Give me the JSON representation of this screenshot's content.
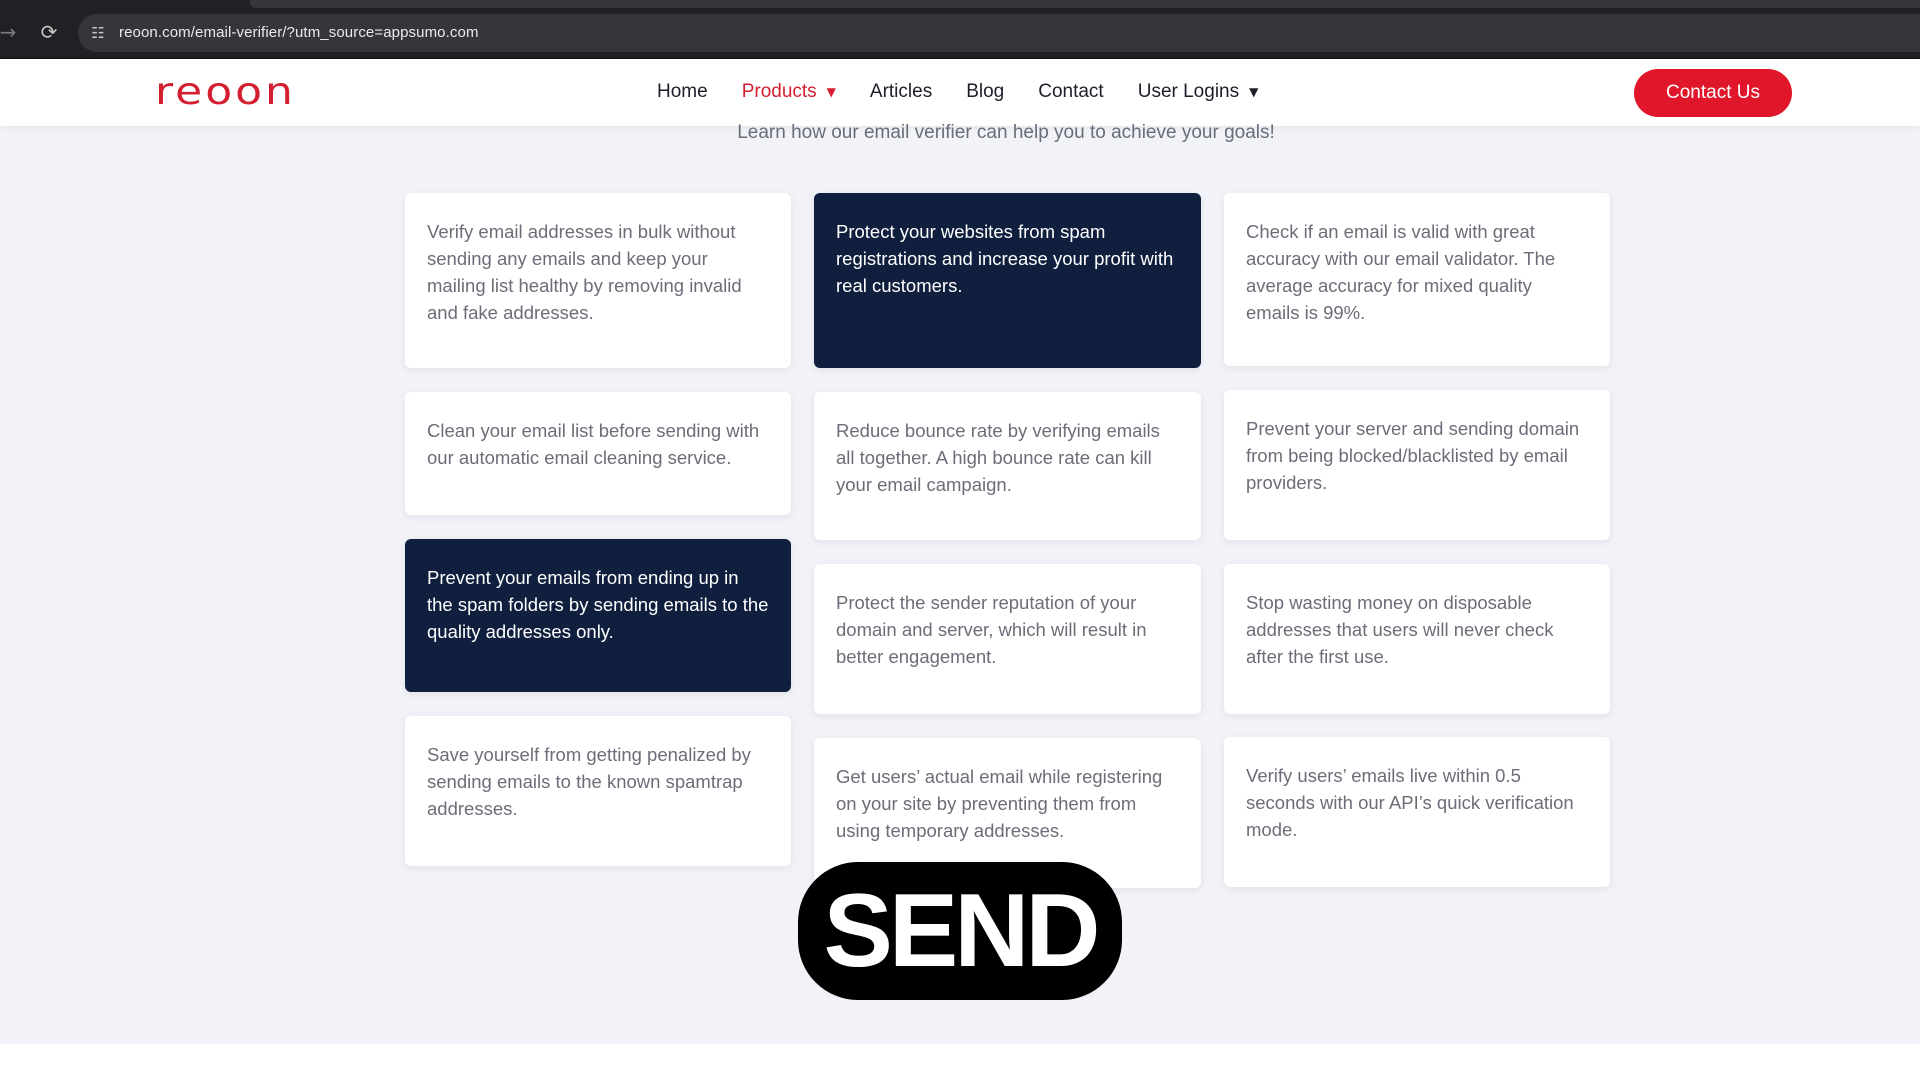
{
  "browser": {
    "url": "reoon.com/email-verifier/?utm_source=appsumo.com"
  },
  "header": {
    "logo_text": "reoon",
    "menu": [
      {
        "label": "Home"
      },
      {
        "label": "Products"
      },
      {
        "label": "Articles"
      },
      {
        "label": "Blog"
      },
      {
        "label": "Contact"
      },
      {
        "label": "User Logins"
      }
    ],
    "contact_button": "Contact Us"
  },
  "main": {
    "subtitle": "Learn how our email verifier can help you to achieve your goals!",
    "cards": [
      {
        "text": "Verify email addresses in bulk without sending any emails and keep your mailing list healthy by removing invalid and fake addresses."
      },
      {
        "text": "Protect your websites from spam registrations and increase your profit with real customers."
      },
      {
        "text": "Check if an email is valid with great accuracy with our email validator. The average accuracy for mixed quality emails is 99%."
      },
      {
        "text": "Clean your email list before sending with our automatic email cleaning service."
      },
      {
        "text": "Reduce bounce rate by verifying emails all together. A high bounce rate can kill your email campaign."
      },
      {
        "text": "Prevent your server and sending domain from being blocked/blacklisted by email providers."
      },
      {
        "text": "Prevent your emails from ending up in the spam folders by sending emails to the quality addresses only."
      },
      {
        "text": "Protect the sender reputation of your domain and server, which will result in better engagement."
      },
      {
        "text": "Stop wasting money on disposable addresses that users will never check after the first use."
      },
      {
        "text": "Save yourself from getting penalized by sending emails to the known spamtrap addresses."
      },
      {
        "text": "Get users’ actual email while registering on your site by preventing them from using temporary addresses."
      },
      {
        "text": "Verify users’ emails live within 0.5 seconds with our API’s quick verification mode."
      }
    ]
  },
  "overlay": {
    "caption": "SEND"
  },
  "colors": {
    "accent": "#e0162b",
    "dark_card": "#0f1f3d"
  }
}
